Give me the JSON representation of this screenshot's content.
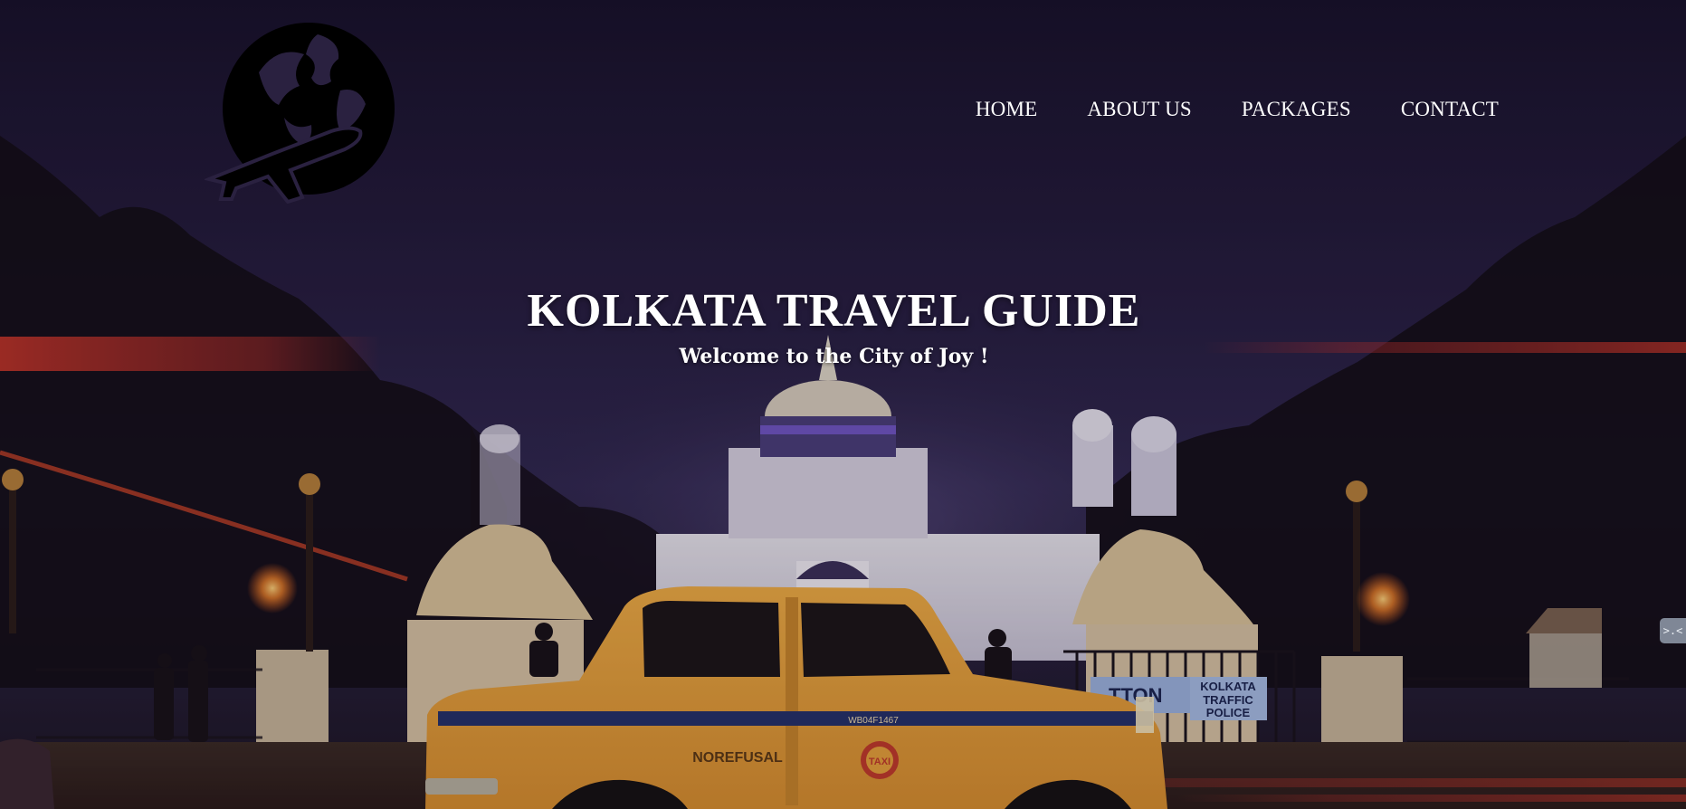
{
  "header": {
    "logo_icon": "globe-airplane-icon",
    "nav": [
      {
        "label": "HOME"
      },
      {
        "label": "ABOUT US"
      },
      {
        "label": "PACKAGES"
      },
      {
        "label": "CONTACT"
      }
    ]
  },
  "hero": {
    "title": "KOLKATA TRAVEL GUIDE",
    "subtitle": "Welcome to the City of Joy !",
    "background_image": "victoria-memorial-night-taxi-photo",
    "taxi_text": {
      "side_text": "NOREFUSAL",
      "emblem_text": "TAXI",
      "plate_text": "WB04F1467"
    },
    "sign_text": {
      "left": "TTON",
      "right_line1": "KOLKATA",
      "right_line2": "TRAFFIC",
      "right_line3": "POLICE"
    }
  },
  "side_widget": {
    "icon": "expand-collapse-icon",
    "label": ">.<"
  },
  "colors": {
    "sky_top": "#1b1430",
    "sky_mid": "#2c2346",
    "taxi_yellow": "#e8a23a",
    "taxi_stripe": "#24306a",
    "streak_red": "#d8382a",
    "text": "#ffffff"
  }
}
